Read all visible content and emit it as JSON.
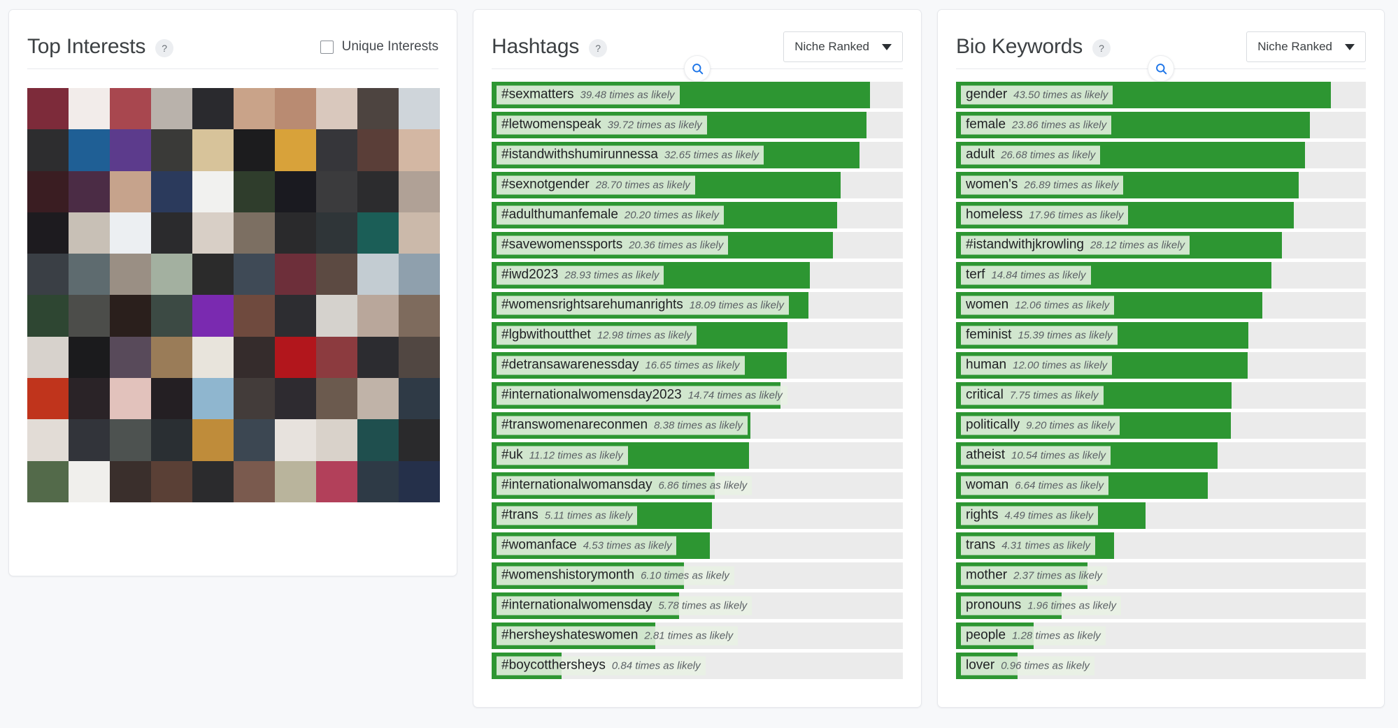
{
  "panels": {
    "interests": {
      "title": "Top Interests",
      "help": "?",
      "unique_label": "Unique Interests",
      "unique_checked": false
    },
    "hashtags": {
      "title": "Hashtags",
      "help": "?",
      "sort_label": "Niche Ranked",
      "search_icon": "search-icon",
      "unit": "times as likely"
    },
    "keywords": {
      "title": "Bio Keywords",
      "help": "?",
      "sort_label": "Niche Ranked",
      "search_icon": "search-icon",
      "unit": "times as likely"
    }
  },
  "colors": {
    "bar_fill": "#2d9632",
    "bar_track": "#ebebeb",
    "accent": "#1a73e8",
    "page_bg": "#f7f8fa"
  },
  "chart_data": [
    {
      "type": "bar",
      "title": "Hashtags",
      "orientation": "horizontal",
      "xlabel": "",
      "ylabel": "",
      "value_suffix": "times as likely",
      "sort": "Niche Ranked",
      "bar_max_pct": 100,
      "categories": [
        "#sexmatters",
        "#letwomenspeak",
        "#istandwithshumirunnessa",
        "#sexnotgender",
        "#adulthumanfemale",
        "#savewomenssports",
        "#iwd2023",
        "#womensrightsarehumanrights",
        "#lgbwithoutthet",
        "#detransawarenessday",
        "#internationalwomensday2023",
        "#transwomenareconmen",
        "#uk",
        "#internationalwomansday",
        "#trans",
        "#womanface",
        "#womenshistorymonth",
        "#internationalwomensday",
        "#hersheyshateswomen",
        "#boycotthersheys"
      ],
      "values": [
        39.48,
        39.72,
        32.65,
        28.7,
        20.2,
        20.36,
        28.93,
        18.09,
        12.98,
        16.65,
        14.74,
        8.38,
        11.12,
        6.86,
        5.11,
        4.53,
        6.1,
        5.78,
        2.81,
        0.84
      ],
      "bar_pct": [
        92.0,
        91.2,
        89.5,
        84.8,
        84.0,
        83.0,
        77.3,
        77.0,
        72.0,
        71.7,
        70.2,
        63.0,
        62.5,
        54.2,
        53.6,
        53.0,
        46.8,
        45.5,
        39.8,
        17.0
      ]
    },
    {
      "type": "bar",
      "title": "Bio Keywords",
      "orientation": "horizontal",
      "xlabel": "",
      "ylabel": "",
      "value_suffix": "times as likely",
      "sort": "Niche Ranked",
      "bar_max_pct": 100,
      "categories": [
        "gender",
        "female",
        "adult",
        "women's",
        "homeless",
        "#istandwithjkrowling",
        "terf",
        "women",
        "feminist",
        "human",
        "critical",
        "politically",
        "atheist",
        "woman",
        "rights",
        "trans",
        "mother",
        "pronouns",
        "people",
        "lover"
      ],
      "values": [
        43.5,
        23.86,
        26.68,
        26.89,
        17.96,
        28.12,
        14.84,
        12.06,
        15.39,
        12.0,
        7.75,
        9.2,
        10.54,
        6.64,
        4.49,
        4.31,
        2.37,
        1.96,
        1.28,
        0.96
      ],
      "bar_pct": [
        91.5,
        86.3,
        85.2,
        83.7,
        82.4,
        79.5,
        76.9,
        74.7,
        71.4,
        71.2,
        67.3,
        67.1,
        63.8,
        61.5,
        46.2,
        38.5,
        32.1,
        25.8,
        19.0,
        15.0
      ]
    }
  ],
  "mosaic": {
    "rows": 10,
    "cols": 10,
    "tiles": [
      "#7d2b3a",
      "#f2ecea",
      "#a8474f",
      "#b9b2ab",
      "#2a2a2e",
      "#c9a389",
      "#b98b72",
      "#d9c8bd",
      "#4d4440",
      "#cfd5da",
      "#2d2d2f",
      "#1f5f95",
      "#5c3b8c",
      "#3a3a38",
      "#d7c39a",
      "#1c1c1e",
      "#d8a23a",
      "#36363a",
      "#5a3e38",
      "#d3b7a3",
      "#3a1d22",
      "#4b2c45",
      "#c6a38c",
      "#2b3a5c",
      "#f1f1ef",
      "#2f3d2c",
      "#1a1a20",
      "#3b3b3d",
      "#2c2c2e",
      "#b0a196",
      "#1d1b1f",
      "#c8c0b6",
      "#eceff2",
      "#2b2b2d",
      "#d8cfc6",
      "#7c6f62",
      "#2a2a2c",
      "#2f3538",
      "#1b5e57",
      "#cbb9aa",
      "#3a3f45",
      "#5e6b6f",
      "#9a8f84",
      "#a3b0a0",
      "#2b2b2b",
      "#3f4a56",
      "#6d2f3a",
      "#5c4a42",
      "#c3ccd2",
      "#8fa0ad",
      "#2e4632",
      "#4c4d4a",
      "#2a1f1c",
      "#3c4a44",
      "#7a2ab0",
      "#6f4a3e",
      "#2d2d31",
      "#d5d2cd",
      "#b9a79b",
      "#7e6b5d",
      "#d7d2cc",
      "#1b1b1d",
      "#584a5a",
      "#9a7c58",
      "#e8e4dc",
      "#352c2c",
      "#b2161c",
      "#8c3b3f",
      "#2c2c30",
      "#514742",
      "#c0341c",
      "#2a2327",
      "#e2c2bc",
      "#241f23",
      "#8fb6cf",
      "#433c3a",
      "#2e2b30",
      "#6b5a4e",
      "#c0b3a8",
      "#2f3a46",
      "#e2dcd6",
      "#32343a",
      "#4d5250",
      "#2a2f33",
      "#bf8c3a",
      "#3c4752",
      "#e7e2dd",
      "#d9d2ca",
      "#1f4f4e",
      "#2a2a2c",
      "#536a4a",
      "#f0efec",
      "#3a2f2c",
      "#5a4036",
      "#2b2b2d",
      "#7a5a4e",
      "#b9b49c",
      "#b2405a",
      "#2e3a46",
      "#25304a"
    ]
  }
}
